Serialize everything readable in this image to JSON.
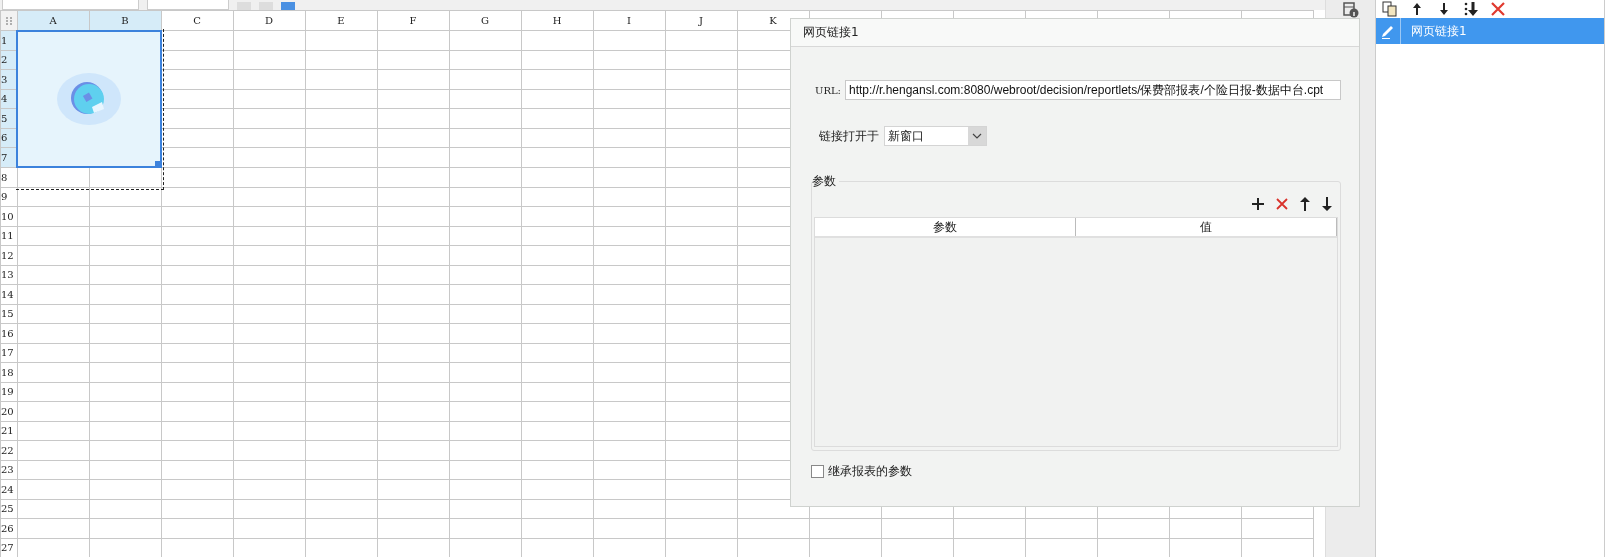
{
  "sheet": {
    "columns": [
      {
        "label": "A",
        "selected": true
      },
      {
        "label": "B",
        "selected": true
      },
      {
        "label": "C",
        "selected": false
      },
      {
        "label": "D",
        "selected": false
      },
      {
        "label": "E",
        "selected": false
      },
      {
        "label": "F",
        "selected": false
      },
      {
        "label": "G",
        "selected": false
      },
      {
        "label": "H",
        "selected": false
      },
      {
        "label": "I",
        "selected": false
      },
      {
        "label": "J",
        "selected": false
      },
      {
        "label": "K",
        "selected": false
      }
    ],
    "rows": [
      {
        "label": "1",
        "selected": true
      },
      {
        "label": "2",
        "selected": true
      },
      {
        "label": "3",
        "selected": true
      },
      {
        "label": "4",
        "selected": true
      },
      {
        "label": "5",
        "selected": true
      },
      {
        "label": "6",
        "selected": true
      },
      {
        "label": "7",
        "selected": true
      },
      {
        "label": "8",
        "selected": false
      },
      {
        "label": "9",
        "selected": false
      },
      {
        "label": "10",
        "selected": false
      },
      {
        "label": "11",
        "selected": false
      },
      {
        "label": "12",
        "selected": false
      },
      {
        "label": "13",
        "selected": false
      },
      {
        "label": "14",
        "selected": false
      },
      {
        "label": "15",
        "selected": false
      },
      {
        "label": "16",
        "selected": false
      },
      {
        "label": "17",
        "selected": false
      },
      {
        "label": "18",
        "selected": false
      },
      {
        "label": "19",
        "selected": false
      },
      {
        "label": "20",
        "selected": false
      },
      {
        "label": "21",
        "selected": false
      },
      {
        "label": "22",
        "selected": false
      },
      {
        "label": "23",
        "selected": false
      },
      {
        "label": "24",
        "selected": false
      },
      {
        "label": "25",
        "selected": false
      },
      {
        "label": "26",
        "selected": false
      },
      {
        "label": "27",
        "selected": false
      }
    ]
  },
  "dialog": {
    "title": "网页链接1",
    "url_label": "URL:",
    "url": "http://r.hengansl.com:8080/webroot/decision/reportlets/保费部报表/个险日报-数据中台.cpt",
    "open_label": "链接打开于",
    "open_value": "新窗口",
    "params_group": "参数",
    "params_columns": [
      "参数",
      "值"
    ],
    "inherit": {
      "label": "继承报表的参数",
      "checked": false
    }
  },
  "panel": {
    "items": [
      {
        "label": "网页链接1",
        "selected": true
      }
    ]
  }
}
